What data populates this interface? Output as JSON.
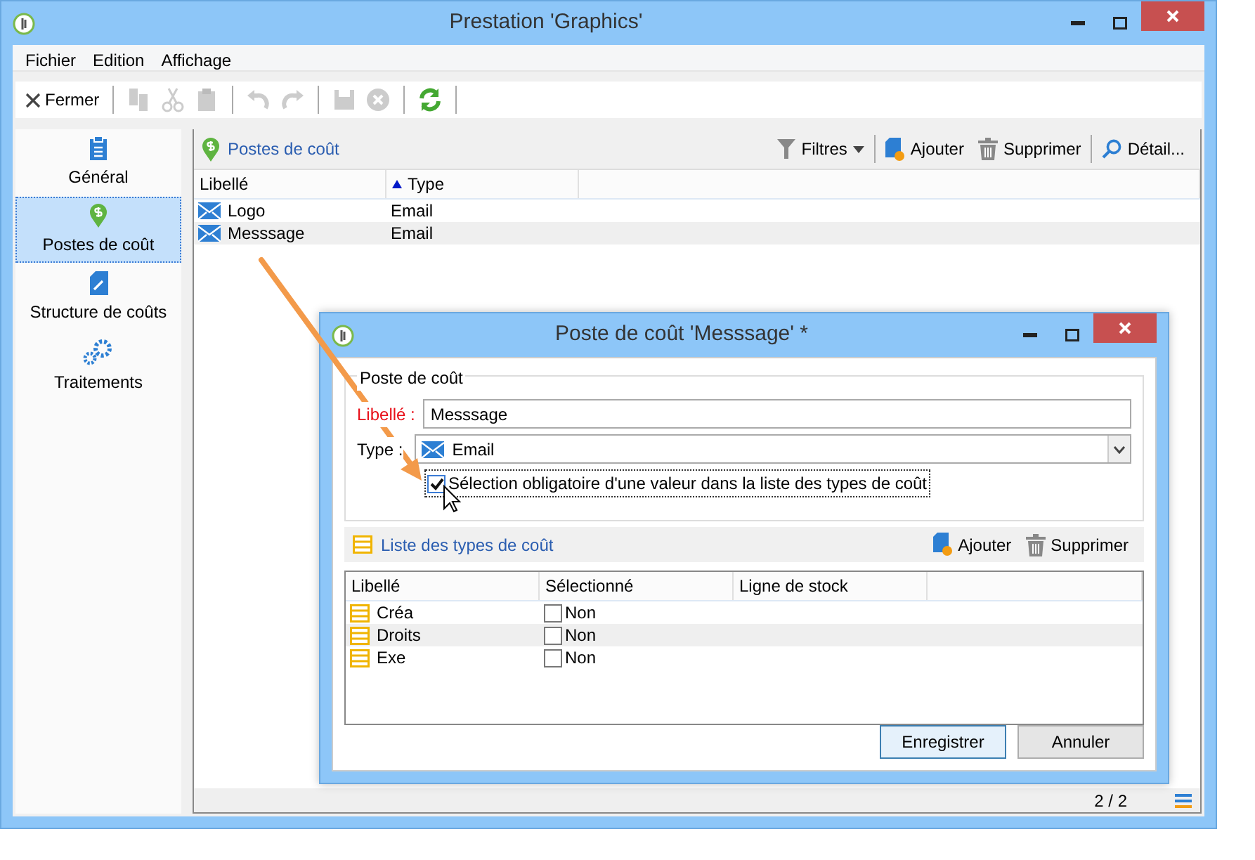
{
  "window": {
    "title": "Prestation 'Graphics'"
  },
  "menu": [
    "Fichier",
    "Edition",
    "Affichage"
  ],
  "toolbar": {
    "close_label": "Fermer"
  },
  "sidebar": {
    "items": [
      {
        "label": "Général",
        "kind": "clipboard",
        "selected": false
      },
      {
        "label": "Postes de coût",
        "kind": "pin",
        "selected": true
      },
      {
        "label": "Structure de coûts",
        "kind": "document",
        "selected": false
      },
      {
        "label": "Traitements",
        "kind": "gears",
        "selected": false
      }
    ]
  },
  "panel": {
    "title": "Postes de coût",
    "actions": [
      {
        "label": "Filtres",
        "kind": "filter"
      },
      {
        "label": "Ajouter",
        "kind": "add"
      },
      {
        "label": "Supprimer",
        "kind": "delete"
      },
      {
        "label": "Détail...",
        "kind": "detail"
      }
    ]
  },
  "table": {
    "columns": [
      {
        "label": "Libellé",
        "sorted": false
      },
      {
        "label": "Type",
        "sorted": true
      }
    ],
    "rows": [
      {
        "cells": [
          "Logo",
          "Email"
        ]
      },
      {
        "cells": [
          "Messsage",
          "Email"
        ]
      }
    ]
  },
  "status_bar": {
    "count": "2 / 2"
  },
  "dialog": {
    "title": "Poste de coût 'Messsage' *",
    "group": "Poste de coût",
    "label_field": {
      "label": "Libellé :",
      "value": "Messsage",
      "required": true
    },
    "type_field": {
      "label": "Type :",
      "value": "Email"
    },
    "checkbox": {
      "label": "Sélection obligatoire d'une valeur dans la liste des types de coût",
      "checked": true
    },
    "list": {
      "title": "Liste des types de coût",
      "actions": [
        {
          "label": "Ajouter",
          "kind": "add"
        },
        {
          "label": "Supprimer",
          "kind": "delete"
        }
      ],
      "columns": [
        "Libellé",
        "Sélectionné",
        "Ligne de stock"
      ],
      "rows": [
        {
          "label": "Créa",
          "value": "Non",
          "checked": false
        },
        {
          "label": "Droits",
          "value": "Non",
          "checked": false
        },
        {
          "label": "Exe",
          "value": "Non",
          "checked": false
        }
      ]
    },
    "buttons": [
      {
        "label": "Enregistrer",
        "default": true
      },
      {
        "label": "Annuler",
        "default": false
      }
    ]
  }
}
